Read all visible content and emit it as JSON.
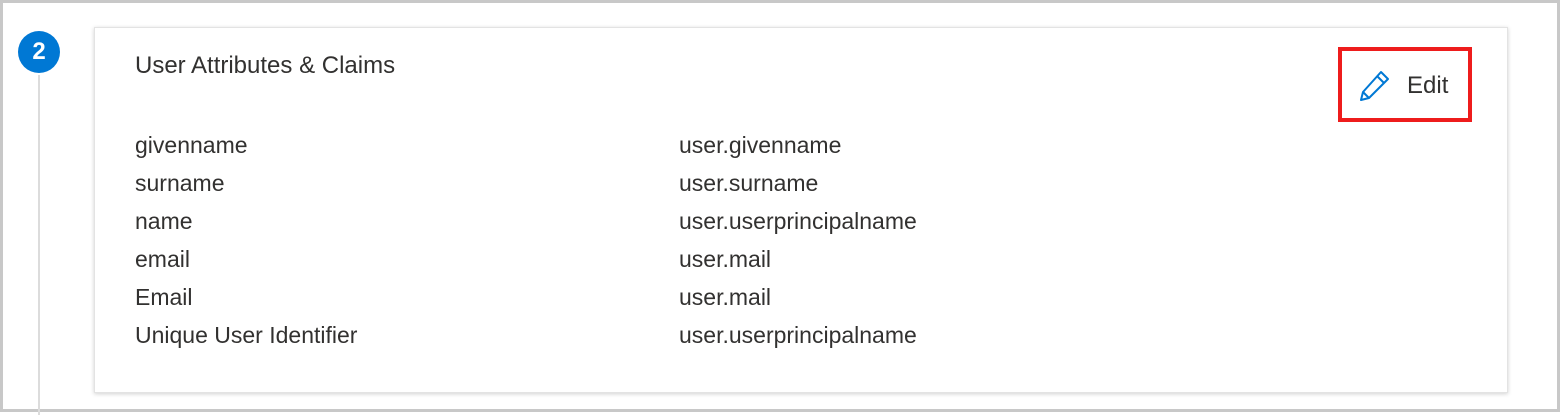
{
  "step": {
    "number": "2"
  },
  "card": {
    "title": "User Attributes & Claims",
    "edit_label": "Edit",
    "edit_icon": "pencil-icon",
    "claims": [
      {
        "name": "givenname",
        "value": "user.givenname"
      },
      {
        "name": "surname",
        "value": "user.surname"
      },
      {
        "name": "name",
        "value": "user.userprincipalname"
      },
      {
        "name": "email",
        "value": "user.mail"
      },
      {
        "name": "Email",
        "value": "user.mail"
      },
      {
        "name": "Unique User Identifier",
        "value": "user.userprincipalname"
      }
    ]
  },
  "colors": {
    "accent": "#0078d4",
    "highlight": "#ee1c1c",
    "text": "#323130"
  }
}
